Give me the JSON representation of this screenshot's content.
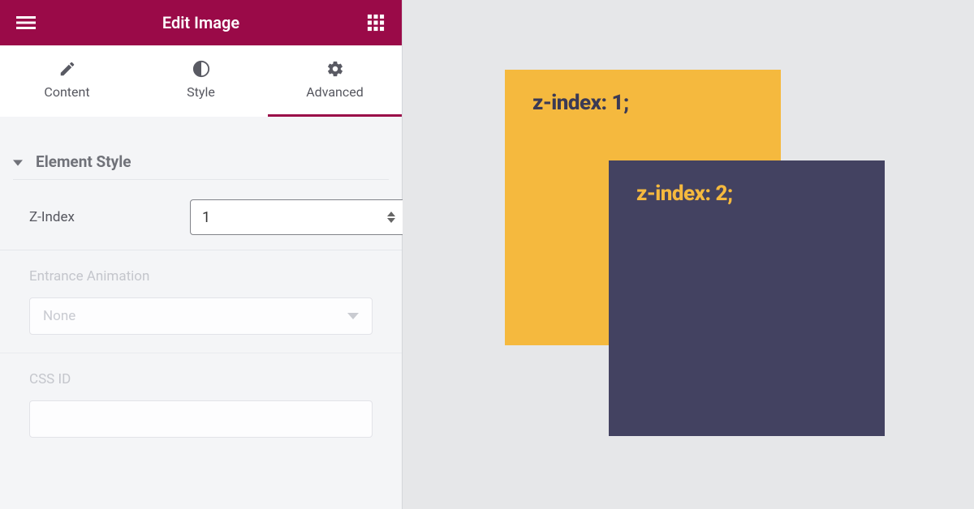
{
  "header": {
    "title": "Edit Image"
  },
  "tabs": {
    "content": {
      "label": "Content"
    },
    "style": {
      "label": "Style"
    },
    "advanced": {
      "label": "Advanced"
    }
  },
  "section": {
    "title": "Element Style",
    "zindex": {
      "label": "Z-Index",
      "value": "1"
    },
    "anim": {
      "label": "Entrance Animation",
      "value": "None"
    },
    "cssid": {
      "label": "CSS ID",
      "value": ""
    }
  },
  "demo": {
    "box1_text": "z-index: 1;",
    "box2_text": "z-index: 2;"
  }
}
